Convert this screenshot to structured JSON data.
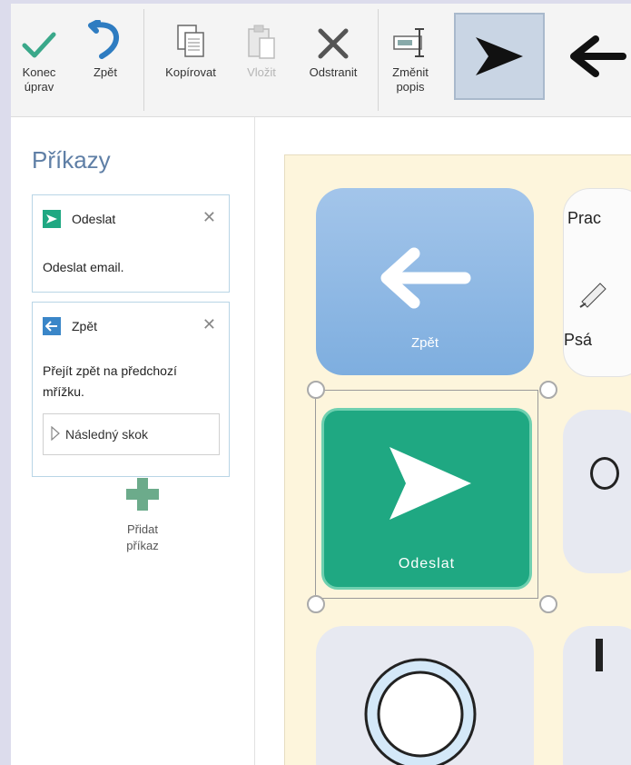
{
  "toolbar": {
    "done": "Konec úprav",
    "undo": "Zpět",
    "copy": "Kopírovat",
    "paste": "Vložit",
    "delete": "Odstranit",
    "change_label": "Změnit popis"
  },
  "panel": {
    "title": "Příkazy",
    "commands": [
      {
        "name": "Odeslat",
        "desc": "Odeslat email."
      },
      {
        "name": "Zpět",
        "desc": "Přejít zpět na předchozí mřížku.",
        "jump": "Následný skok"
      }
    ],
    "add_label": "Přidat příkaz"
  },
  "grid": {
    "back_label": "Zpět",
    "send_label": "Odeslat",
    "partial_top_text": "Prac",
    "partial_mid_text": "Psá"
  },
  "colors": {
    "accent_green": "#1fa882",
    "accent_blue": "#3a86c8",
    "title_blue": "#5f7fa6",
    "grid_bg": "#fdf5dc"
  },
  "icons": [
    "checkmark-icon",
    "undo-icon",
    "copy-icon",
    "paste-icon",
    "delete-x-icon",
    "change-label-icon",
    "send-arrow-icon",
    "back-arrow-icon",
    "close-icon",
    "plus-icon",
    "play-outline-icon"
  ]
}
